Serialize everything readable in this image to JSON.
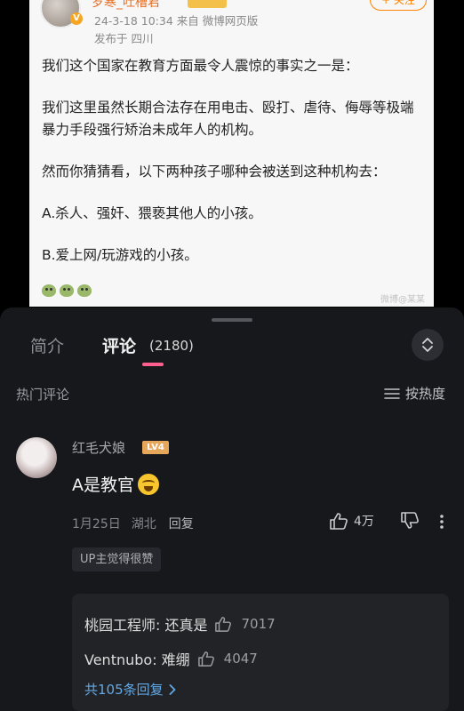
{
  "post": {
    "author": "岁寒_吐槽君",
    "follow_label": "+ 关注",
    "meta": "24-3-18 10:34  来自 微博网页版",
    "location": "发布于 四川",
    "paragraphs": [
      "我们这个国家在教育方面最令人震惊的事实之一是：",
      "我们这里虽然长期合法存在用电击、殴打、虐待、侮辱等极端暴力手段强行矫治未成年人的机构。",
      "然而你猜猜看，以下两种孩子哪种会被送到这种机构去：",
      "A.杀人、强奸、猥亵其他人的小孩。",
      "B.爱上网/玩游戏的小孩。"
    ],
    "watermark": "微博@某某"
  },
  "panel": {
    "tab_intro": "简介",
    "tab_comments": "评论",
    "comment_count": "(2180)",
    "hot_label": "热门评论",
    "sort_label": "按热度"
  },
  "comment": {
    "user": "红毛犬娘",
    "level": "LV4",
    "text": "A是教官",
    "date": "1月25日",
    "region": "湖北",
    "reply_label": "回复",
    "likes": "4万",
    "up_tag": "UP主觉得很赞",
    "replies": [
      {
        "text": "桃园工程师: 还真是",
        "likes": "7017"
      },
      {
        "text": "Ventnubo: 难绷",
        "likes": "4047"
      }
    ],
    "more_replies": "共105条回复"
  },
  "colors": {
    "panel_bg": "#17181c",
    "accent_pink": "#ff5f8f",
    "link_blue": "#62a8e4",
    "post_author_orange": "#e86b1f"
  }
}
